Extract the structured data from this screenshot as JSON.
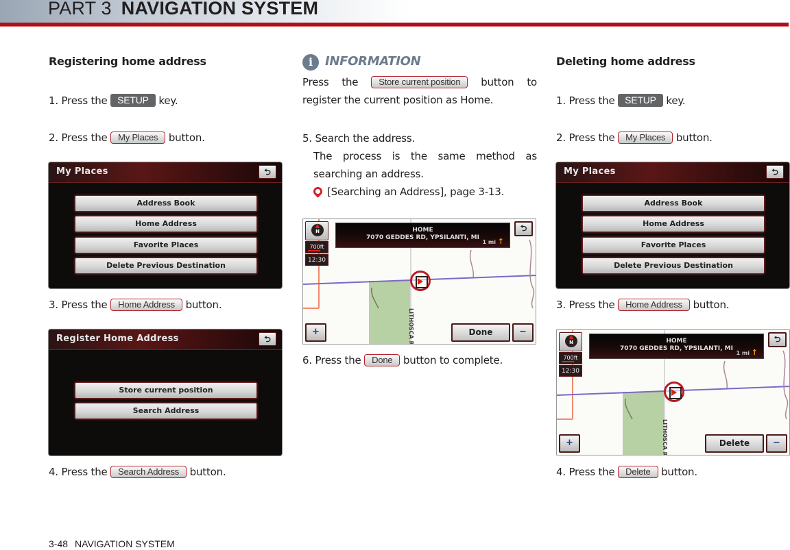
{
  "header": {
    "part": "PART 3",
    "title": "NAVIGATION SYSTEM"
  },
  "colors": {
    "accent_red": "#a8121e",
    "info_gray": "#6d7b8d",
    "key_gray": "#636466"
  },
  "left": {
    "title": "Registering home address",
    "steps": [
      {
        "pre": "1. Press the ",
        "key": "SETUP",
        "post": " key."
      },
      {
        "pre": "2. Press the ",
        "key": "My Places",
        "post": " button."
      },
      {
        "pre": "3. Press the ",
        "key": "Home Address",
        "post": " button."
      },
      {
        "pre": "4. Press the ",
        "key": "Search Address",
        "post": " button."
      }
    ],
    "screen1": {
      "title": "My Places",
      "back_icon": "⮌",
      "buttons": [
        "Address Book",
        "Home Address",
        "Favorite Places",
        "Delete Previous Destination"
      ]
    },
    "screen2": {
      "title": "Register Home Address",
      "back_icon": "⮌",
      "buttons": [
        "Store current position",
        "Search Address"
      ]
    }
  },
  "middle": {
    "info_label": "INFORMATION",
    "info_icon": "i",
    "info_pre": "Press the ",
    "info_key": "Store current position",
    "info_post": " button to register the current position as Home.",
    "step5": "5. Search the address.",
    "step5_detail": "The process is the same method as searching an address.",
    "step5_ref": "[Searching an Address], page 3-13.",
    "step6": {
      "pre": "6. Press the ",
      "key": "Done",
      "post": " button to complete."
    },
    "map": {
      "dest_label": "HOME",
      "address": "7070 GEDDES RD, YPSILANTI, MI",
      "distance": "1 mi",
      "scale": "700ft",
      "time": "12:30",
      "action": "Done",
      "zoom_in": "+",
      "zoom_out": "−",
      "road_name": "LITHOSCA R"
    }
  },
  "right": {
    "title": "Deleting home address",
    "steps": [
      {
        "pre": "1. Press the ",
        "key": "SETUP",
        "post": " key."
      },
      {
        "pre": "2. Press the ",
        "key": "My Places",
        "post": " button."
      },
      {
        "pre": "3. Press the ",
        "key": "Home Address",
        "post": " button."
      },
      {
        "pre": "4. Press the ",
        "key": "Delete",
        "post": " button."
      }
    ],
    "screen1": {
      "title": "My Places",
      "back_icon": "⮌",
      "buttons": [
        "Address Book",
        "Home Address",
        "Favorite Places",
        "Delete Previous Destination"
      ]
    },
    "map": {
      "dest_label": "HOME",
      "address": "7070 GEDDES RD, YPSILANTI, MI",
      "distance": "1 mi",
      "scale": "700ft",
      "time": "12:30",
      "action": "Delete",
      "zoom_in": "+",
      "zoom_out": "−",
      "road_name": "LITHOSCA R"
    }
  },
  "footer": {
    "page": "3-48",
    "section": "NAVIGATION SYSTEM"
  }
}
